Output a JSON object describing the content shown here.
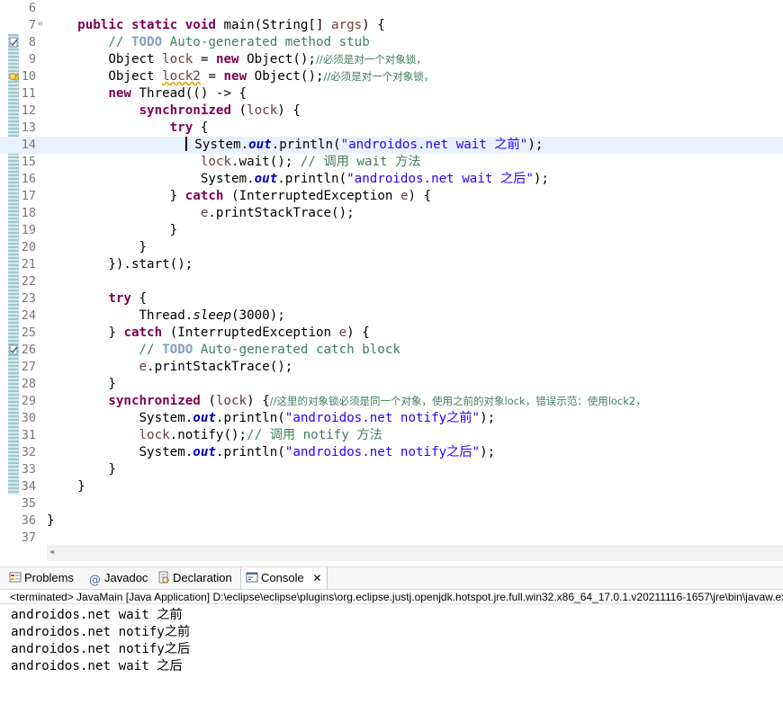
{
  "editor": {
    "current_line": 14,
    "line_numbers": [
      "6",
      "7",
      "8",
      "9",
      "10",
      "11",
      "12",
      "13",
      "14",
      "15",
      "16",
      "17",
      "18",
      "19",
      "20",
      "21",
      "22",
      "23",
      "24",
      "25",
      "26",
      "27",
      "28",
      "29",
      "30",
      "31",
      "32",
      "33",
      "34",
      "35",
      "36",
      "37"
    ],
    "fold_marker_line": "7",
    "task_marker_lines": [
      "8",
      "26"
    ],
    "warning_marker_line": "10",
    "code": {
      "l7_mods": "public static void",
      "l7_rest": " main(String[] ",
      "l7_param": "args",
      "l7_end": ") {",
      "l8_comment_pre": "// ",
      "l8_todo": "TODO",
      "l8_comment_post": " Auto-generated method stub",
      "l9_type": "Object ",
      "l9_var": "lock",
      "l9_eq": " = ",
      "l9_new": "new",
      "l9_rest": " Object();",
      "l9_comment": "//必须是对一个对象锁，",
      "l10_type": "Object ",
      "l10_var": "lock2",
      "l10_eq": " = ",
      "l10_new": "new",
      "l10_rest": " Object();",
      "l10_comment": "//必须是对一个对象锁，",
      "l11_new": "new",
      "l11_rest": " Thread(() -> {",
      "l12_sync": "synchronized",
      "l12_open": " (",
      "l12_var": "lock",
      "l12_close": ") {",
      "l13_try": "try",
      "l13_brace": " {",
      "l14_pre": "System.",
      "l14_out": "out",
      "l14_call": ".println(",
      "l14_str": "\"androidos.net wait 之前\"",
      "l14_end": ");",
      "l15_var": "lock",
      "l15_call": ".wait(); ",
      "l15_comment": "// 调用 wait 方法",
      "l16_pre": "System.",
      "l16_out": "out",
      "l16_call": ".println(",
      "l16_str": "\"androidos.net wait 之后\"",
      "l16_end": ");",
      "l17_brace": "} ",
      "l17_catch": "catch",
      "l17_open": " (InterruptedException ",
      "l17_var": "e",
      "l17_close": ") {",
      "l18_var": "e",
      "l18_call": ".printStackTrace();",
      "l19": "}",
      "l20": "}",
      "l21": "}).start();",
      "l23_try": "try",
      "l23_brace": " {",
      "l24_pre": "Thread.",
      "l24_sleep": "sleep",
      "l24_args": "(3000);",
      "l25_brace": "} ",
      "l25_catch": "catch",
      "l25_open": " (InterruptedException ",
      "l25_var": "e",
      "l25_close": ") {",
      "l26_comment_pre": "// ",
      "l26_todo": "TODO",
      "l26_comment_post": " Auto-generated catch block",
      "l27_var": "e",
      "l27_call": ".printStackTrace();",
      "l28": "}",
      "l29_sync": "synchronized",
      "l29_open": " (",
      "l29_var": "lock",
      "l29_close": ") {",
      "l29_comment": "//这里的对象锁必须是同一个对象，使用之前的对象lock，错误示范：使用lock2，",
      "l30_pre": "System.",
      "l30_out": "out",
      "l30_call": ".println(",
      "l30_str": "\"androidos.net notify之前\"",
      "l30_end": ");",
      "l31_var": "lock",
      "l31_call": ".notify();",
      "l31_comment": "// 调用 notify 方法",
      "l32_pre": "System.",
      "l32_out": "out",
      "l32_call": ".println(",
      "l32_str": "\"androidos.net notify之后\"",
      "l32_end": ");",
      "l33": "}",
      "l34": "}",
      "l36": "}"
    }
  },
  "views": {
    "tabs": [
      {
        "label": "Problems",
        "icon": "problems-icon"
      },
      {
        "label": "Javadoc",
        "icon": "javadoc-icon"
      },
      {
        "label": "Declaration",
        "icon": "declaration-icon"
      },
      {
        "label": "Console",
        "icon": "console-icon",
        "active": true
      }
    ],
    "close_glyph": "✕"
  },
  "console": {
    "status": "<terminated> JavaMain [Java Application] D:\\eclipse\\eclipse\\plugins\\org.eclipse.justj.openjdk.hotspot.jre.full.win32.x86_64_17.0.1.v20211116-1657\\jre\\bin\\javaw.exe",
    "lines": [
      "androidos.net wait 之前",
      "androidos.net notify之前",
      "androidos.net notify之后",
      "androidos.net wait 之后"
    ]
  },
  "colors": {
    "keyword": "#7f0055",
    "comment": "#3f7f5f",
    "string": "#2a00ff",
    "field": "#0000c0",
    "variable": "#6a3e3e",
    "current_line": "#e8f2fe"
  }
}
